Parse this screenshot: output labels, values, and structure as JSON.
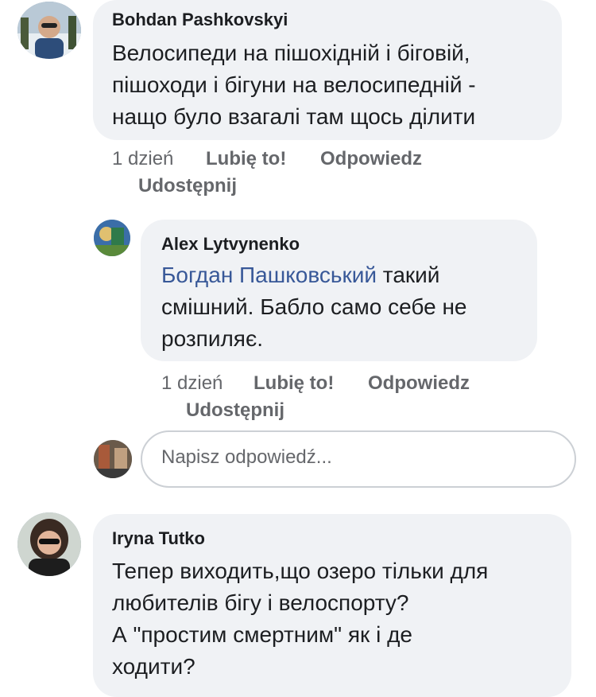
{
  "comments": [
    {
      "author": "Bohdan Pashkovskyi",
      "lines": [
        "Велосипеди на пішохідній і біговій,",
        "пішоходи і бігуни на велосипедній -",
        "нащо було взагалі там щось ділити"
      ],
      "time": "1 dzień",
      "like": "Lubię to!",
      "reply": "Odpowiedz",
      "share": "Udostępnij"
    },
    {
      "author": "Alex Lytvynenko",
      "mention": "Богдан Пашковський",
      "line1_rest": " такий",
      "lines": [
        "смішний. Бабло само себе не",
        "розпиляє."
      ],
      "time": "1 dzień",
      "like": "Lubię to!",
      "reply": "Odpowiedz",
      "share": "Udostępnij"
    },
    {
      "author": "Iryna Tutko",
      "lines": [
        "Тепер виходить,що озеро тільки для",
        "любителів бігу і велоспорту?",
        "А \"простим смертним\" як і де",
        "ходити?"
      ]
    }
  ],
  "reply_input": {
    "placeholder": "Napisz odpowiedź..."
  },
  "colors": {
    "bubble": "#f0f2f5",
    "mention": "#385898",
    "meta": "#65676b"
  }
}
